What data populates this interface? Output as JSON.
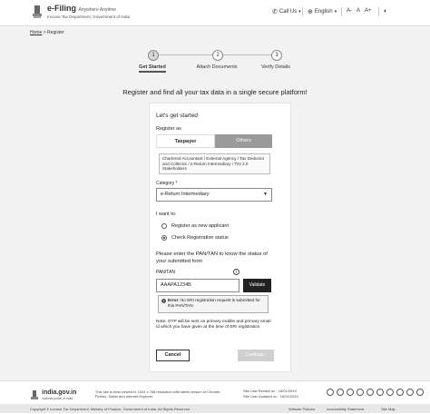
{
  "header": {
    "brand_title": "e-Filing",
    "brand_hindi": "Anywhere Anytime",
    "brand_sub": "Income Tax Department, Government of India",
    "call_label": "Call Us",
    "language_label": "English",
    "font_decrease": "A-",
    "font_reset": "A",
    "font_increase": "A+"
  },
  "breadcrumb": {
    "home": "Home",
    "sep": ">",
    "current": "Register"
  },
  "steps": [
    {
      "num": "1",
      "label": "Get Started",
      "active": true
    },
    {
      "num": "2",
      "label": "Attach Documents",
      "active": false
    },
    {
      "num": "3",
      "label": "Verify Details",
      "active": false
    }
  ],
  "tagline": "Register and find all your tax data in a single secure platform!",
  "form": {
    "heading": "Let's get started",
    "register_as": "Register as",
    "tab_taxpayer": "Taxpayer",
    "tab_others": "Others",
    "others_desc": "Chartered Accountant / External Agency / Tax Deductor and Collector / e-Return Intermediary / TIN 2.0 Stakeholders",
    "category_label": "Category *",
    "category_value": "e-Return Intermediary",
    "want_label": "I want to:",
    "option_new": "Register as new applicant",
    "option_check": "Check Registration status",
    "pan_prompt": "Please enter the PAN/TAN to know the status of your submitted form",
    "pan_label": "PAN/TAN",
    "info_glyph": "i",
    "pan_value": "AAAPA1234B",
    "validate": "Validate",
    "error_label": "Error:",
    "error_text": "No ERI registration request is submitted for this PAN/TAN",
    "note": "Note: OTP will be sent on primary mobile and primary email id which you have given at the time of ERI registration",
    "cancel": "Cancel",
    "continue": "Continue"
  },
  "footer": {
    "site": "india.gov.in",
    "site_sub": "national portal of india",
    "best_viewed": "This site is best viewed in 1024 x 768 resolution with latest version of Chrome, Firefox, Safari and Internet Explorer.",
    "last_review_label": "Site Last Review on :",
    "last_review": "10/01/2019",
    "last_updated_label": "Site Last Updated on :",
    "last_updated": "10/01/2019",
    "link_policies": "Website Policies",
    "link_accessibility": "Accessibility Statement",
    "link_sitemap": "Site Map",
    "copyright": "Copyright © Income Tax Department, Ministry of Finance, Government of India. All Rights Reserved"
  }
}
